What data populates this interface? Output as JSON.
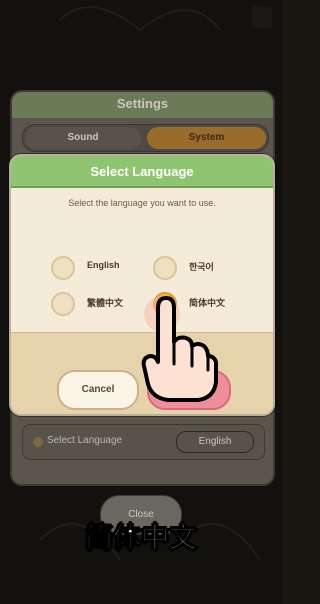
{
  "settings": {
    "title": "Settings",
    "tabs": [
      {
        "label": "Sound",
        "active": false
      },
      {
        "label": "System",
        "active": true
      }
    ],
    "language_row": {
      "label": "Select Language",
      "value": "English"
    },
    "close_label": "Close"
  },
  "dialog": {
    "title": "Select Language",
    "subtitle": "Select the language you want to use.",
    "options": [
      {
        "label": "English",
        "selected": false
      },
      {
        "label": "한국어",
        "selected": false
      },
      {
        "label": "繁體中文",
        "selected": false
      },
      {
        "label": "简体中文",
        "selected": true
      }
    ],
    "cancel_label": "Cancel"
  },
  "caption": "简体中文",
  "colors": {
    "header_green": "#8fc470",
    "selected_orange": "#f4b04a",
    "confirm_pink": "#ef8e9b"
  }
}
